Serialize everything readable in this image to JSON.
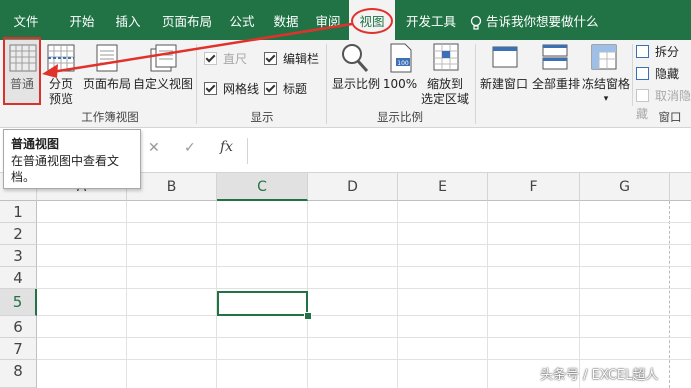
{
  "tabs": [
    "文件",
    "开始",
    "插入",
    "页面布局",
    "公式",
    "数据",
    "审阅",
    "视图",
    "开发工具"
  ],
  "active_tab": "视图",
  "tell_me": "告诉我你想要做什么",
  "workbook_views": {
    "normal": "普通",
    "page_break_line1": "分页",
    "page_break_line2": "预览",
    "page_layout": "页面布局",
    "custom_views": "自定义视图",
    "group_label": "工作簿视图"
  },
  "show": {
    "ruler": "直尺",
    "formula_bar": "编辑栏",
    "gridlines": "网格线",
    "headings": "标题",
    "ruler_checked": true,
    "formula_bar_checked": true,
    "gridlines_checked": true,
    "headings_checked": true,
    "group_label": "显示"
  },
  "zoom": {
    "zoom": "显示比例",
    "zoom100": "100%",
    "zoom_sel_line1": "缩放到",
    "zoom_sel_line2": "选定区域",
    "group_label": "显示比例"
  },
  "window": {
    "new_window": "新建窗口",
    "arrange_all": "全部重排",
    "freeze_panes": "冻结窗格",
    "split": "拆分",
    "hide": "隐藏",
    "unhide": "取消隐藏",
    "group_label": "窗口"
  },
  "tooltip": {
    "title": "普通视图",
    "desc": "在普通视图中查看文档。"
  },
  "formula_bar": {
    "fx": "fx",
    "cancel": "✕",
    "enter": "✓"
  },
  "columns": [
    "A",
    "B",
    "C",
    "D",
    "E",
    "F",
    "G"
  ],
  "rows": [
    "1",
    "2",
    "3",
    "4",
    "5",
    "6",
    "7",
    "8"
  ],
  "selected_cell": "C5",
  "watermark": "头条号 / EXCEL超人",
  "colors": {
    "excel_green": "#217346",
    "annotation_red": "#e0312b"
  }
}
